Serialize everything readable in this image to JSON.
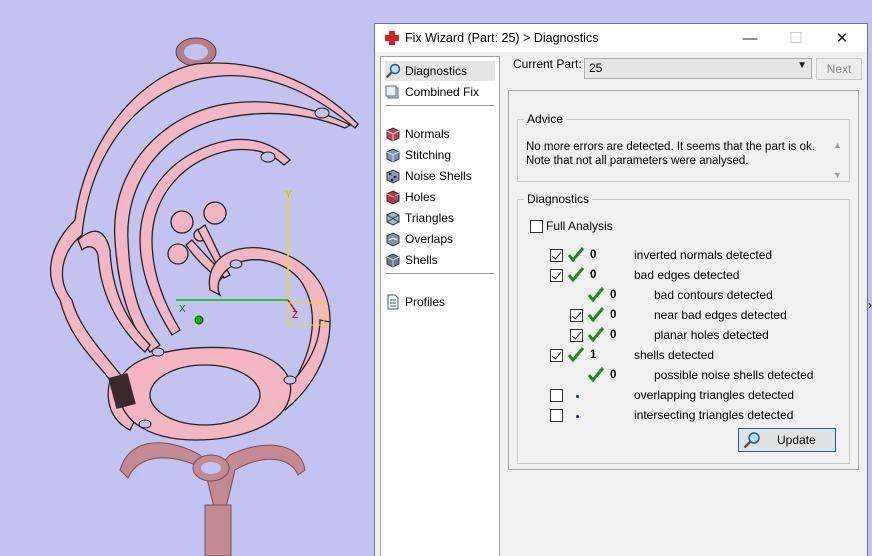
{
  "window": {
    "title": "Fix Wizard (Part: 25) > Diagnostics",
    "minimize": "—",
    "maximize": "☐",
    "close": "✕"
  },
  "nav": {
    "items": [
      {
        "label": "Diagnostics",
        "icon": "magnifier-icon"
      },
      {
        "label": "Combined Fix",
        "icon": "cube-stack-icon"
      },
      {
        "label": "Normals",
        "icon": "normals-cube-icon"
      },
      {
        "label": "Stitching",
        "icon": "stitching-cube-icon"
      },
      {
        "label": "Noise Shells",
        "icon": "noise-shells-icon"
      },
      {
        "label": "Holes",
        "icon": "holes-cube-icon"
      },
      {
        "label": "Triangles",
        "icon": "triangles-icon"
      },
      {
        "label": "Overlaps",
        "icon": "overlaps-cube-icon"
      },
      {
        "label": "Shells",
        "icon": "shells-cube-icon"
      },
      {
        "label": "Profiles",
        "icon": "document-icon"
      }
    ]
  },
  "current_part": {
    "label": "Current Part:",
    "value": "25",
    "next_label": "Next"
  },
  "advice": {
    "legend": "Advice",
    "line1": "No more errors are detected. It seems that the part is ok.",
    "line2": "Note that not all parameters were analysed."
  },
  "diagnostics": {
    "legend": "Diagnostics",
    "full_analysis": "Full Analysis",
    "rows": [
      {
        "count": "0",
        "label": "inverted normals detected"
      },
      {
        "count": "0",
        "label": "bad edges detected"
      },
      {
        "count": "0",
        "label": "bad contours detected"
      },
      {
        "count": "0",
        "label": "near bad edges detected"
      },
      {
        "count": "0",
        "label": "planar holes detected"
      },
      {
        "count": "1",
        "label": "shells detected"
      },
      {
        "count": "0",
        "label": "possible noise shells detected"
      },
      {
        "count": "",
        "label": "overlapping triangles detected"
      },
      {
        "count": "",
        "label": "intersecting triangles detected"
      }
    ],
    "update_label": "Update"
  },
  "viewport": {
    "axis_x": "X",
    "axis_y": "Y",
    "axis_z": "Z",
    "model_color": "#f4b6c2",
    "background": "#c3c3f2"
  },
  "edge_mark": "›"
}
